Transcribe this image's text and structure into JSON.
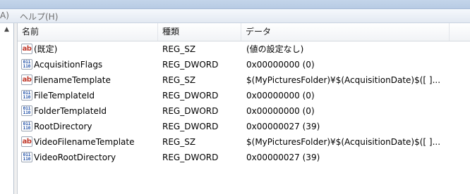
{
  "menubar": {
    "item_a": "A)",
    "help": "ヘルプ(H)"
  },
  "tree": {
    "scroll_up_glyph": "▲"
  },
  "columns": {
    "name": "名前",
    "type": "種類",
    "data": "データ"
  },
  "rows": [
    {
      "name": "(既定)",
      "type": "REG_SZ",
      "data": "(値の設定なし)",
      "icon": "string-value-icon"
    },
    {
      "name": "AcquisitionFlags",
      "type": "REG_DWORD",
      "data": "0x00000000 (0)",
      "icon": "binary-value-icon"
    },
    {
      "name": "FilenameTemplate",
      "type": "REG_SZ",
      "data": "$(MyPicturesFolder)¥$(AcquisitionDate)$([ ]...",
      "icon": "string-value-icon"
    },
    {
      "name": "FileTemplateId",
      "type": "REG_DWORD",
      "data": "0x00000000 (0)",
      "icon": "binary-value-icon"
    },
    {
      "name": "FolderTemplateId",
      "type": "REG_DWORD",
      "data": "0x00000000 (0)",
      "icon": "binary-value-icon"
    },
    {
      "name": "RootDirectory",
      "type": "REG_DWORD",
      "data": "0x00000027 (39)",
      "icon": "binary-value-icon"
    },
    {
      "name": "VideoFilenameTemplate",
      "type": "REG_SZ",
      "data": "$(MyPicturesFolder)¥$(AcquisitionDate)$([ ]...",
      "icon": "string-value-icon"
    },
    {
      "name": "VideoRootDirectory",
      "type": "REG_DWORD",
      "data": "0x00000027 (39)",
      "icon": "binary-value-icon"
    }
  ],
  "icons": {
    "string_glyph": "ab",
    "binary_glyph": "011\n110"
  },
  "colors": {
    "string_icon": "#c0392b",
    "binary_icon": "#1f4fa6"
  }
}
